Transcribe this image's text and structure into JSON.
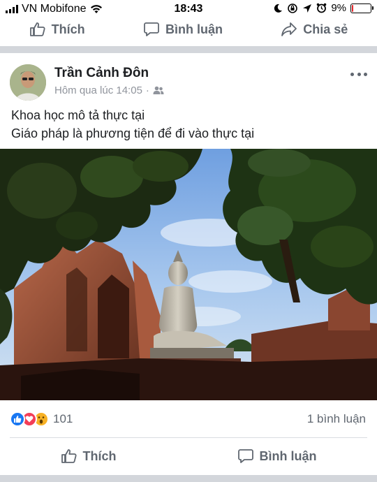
{
  "status_bar": {
    "carrier": "VN Mobifone",
    "time": "18:43",
    "battery_percent": "9%",
    "battery_level": 0.09,
    "icons": [
      "signal-bars-icon",
      "wifi-icon",
      "moon-icon",
      "orientation-lock-icon",
      "location-arrow-icon",
      "alarm-icon",
      "battery-icon"
    ]
  },
  "prev_post_actions": {
    "like": "Thích",
    "comment": "Bình luận",
    "share": "Chia sẻ"
  },
  "post": {
    "author": "Trần Cảnh Đôn",
    "time": "Hôm qua lúc 14:05",
    "separator": "·",
    "audience_icon": "friends-icon",
    "text_lines": [
      "Khoa học mô tả thực tại",
      "Giáo pháp là phương tiện để đi vào thực tại"
    ],
    "photo_description_icon": "buddha-statue-photo",
    "reactions": {
      "icons": [
        "like-reaction-icon",
        "love-reaction-icon",
        "wow-reaction-icon"
      ],
      "count": "101"
    },
    "comments_count": "1 bình luận",
    "actions": {
      "like": "Thích",
      "comment": "Bình luận"
    }
  },
  "colors": {
    "facebook_blue": "#1877f2",
    "separator_gray": "#d3d6db",
    "secondary_text": "#606770",
    "battery_red": "#e3262b"
  }
}
